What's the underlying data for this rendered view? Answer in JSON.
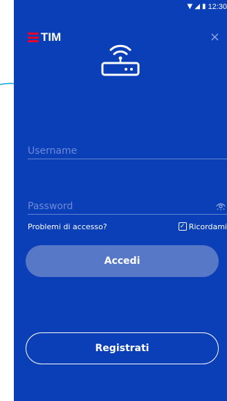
{
  "status_bar": {
    "time": "12:30",
    "wifi_icon": "wifi-icon",
    "signal_icon": "signal-icon",
    "battery_icon": "battery-icon"
  },
  "brand": {
    "logo_text": "TIM",
    "logo_color": "#e4002b"
  },
  "header": {
    "close_label": "×"
  },
  "illustration": {
    "icon": "router-wifi-icon"
  },
  "form": {
    "username_placeholder": "Username",
    "password_placeholder": "Password",
    "help_link": "Problemi di accesso?",
    "remember_label": "Ricordami",
    "remember_checked": true,
    "checkbox_mark": "✓"
  },
  "buttons": {
    "login_label": "Accedi",
    "register_label": "Registrati"
  },
  "colors": {
    "background": "#0b3fb7",
    "login_button": "#5778c7",
    "accent_arrow": "#1aa7e8"
  }
}
